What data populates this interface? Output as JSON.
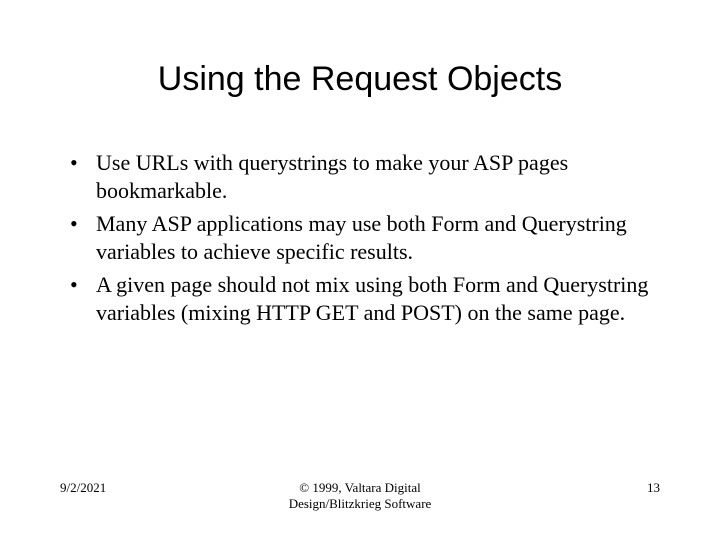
{
  "title": "Using the Request Objects",
  "bullets": [
    "Use URLs with querystrings to make your ASP pages bookmarkable.",
    "Many ASP applications may use both Form and Querystring variables to achieve specific results.",
    "A given page should not mix using both Form and Querystring variables (mixing HTTP GET and POST) on the same page."
  ],
  "footer": {
    "date": "9/2/2021",
    "copyright": "© 1999, Valtara Digital\nDesign/Blitzkrieg Software",
    "page": "13"
  }
}
